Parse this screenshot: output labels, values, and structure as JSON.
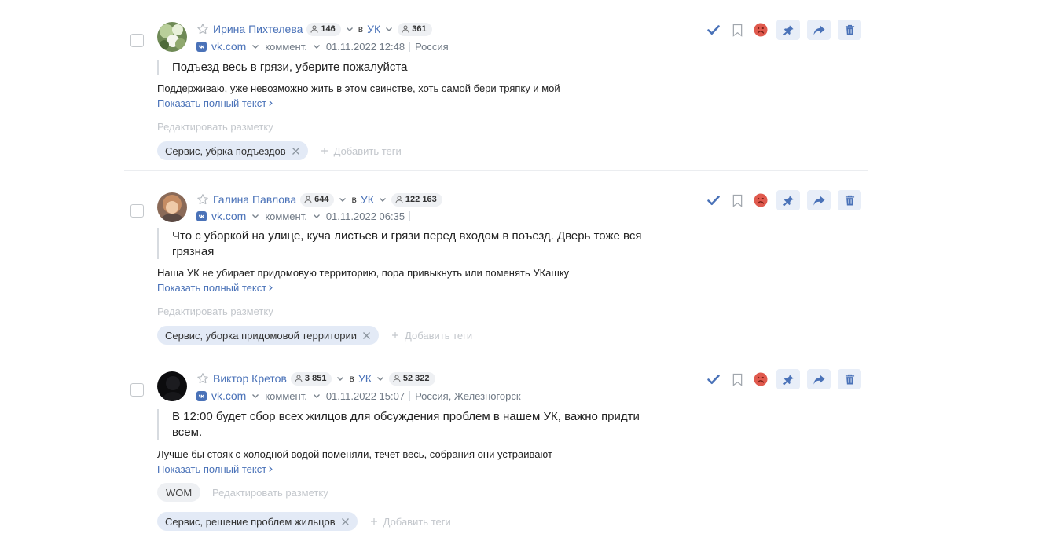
{
  "posts": [
    {
      "author": "Ирина Пихтелева",
      "followers": "146",
      "in_label": "в",
      "uk_label": "УК",
      "reach": "361",
      "source": "vk.com",
      "type": "коммент.",
      "datetime": "01.11.2022 12:48",
      "location": "Россия",
      "quote_lines": [
        "Подъезд весь в грязи, уберите пожалуйста"
      ],
      "comment": "Поддерживаю, уже невозможно жить в этом свинстве, хоть самой бери тряпку и мой",
      "show_full": "Показать полный текст",
      "edit_markup": "Редактировать разметку",
      "tag": "Сервис, убрка подъездов",
      "add_tags": "Добавить теги"
    },
    {
      "author": "Галина Павлова",
      "followers": "644",
      "in_label": "в",
      "uk_label": "УК",
      "reach": "122 163",
      "source": "vk.com",
      "type": "коммент.",
      "datetime": "01.11.2022 06:35",
      "location": "",
      "quote_lines": [
        "Что с уборкой на улице, куча листьев и грязи перед входом в поъезд. Дверь тоже вся",
        "грязная"
      ],
      "comment": "Наша УК не убирает придомовую территорию, пора привыкнуть или поменять УКашку",
      "show_full": "Показать полный текст",
      "edit_markup": "Редактировать разметку",
      "tag": "Сервис, уборка придомовой территории",
      "add_tags": "Добавить теги"
    },
    {
      "author": "Виктор Кретов",
      "followers": "3 851",
      "in_label": "в",
      "uk_label": "УК",
      "reach": "52 322",
      "source": "vk.com",
      "type": "коммент.",
      "datetime": "01.11.2022 15:07",
      "location": "Россия, Железногорск",
      "quote_lines": [
        "В 12:00 будет сбор всех жилцов для обсуждения проблем в нашем УК, важно придти",
        "всем."
      ],
      "comment": "Лучше бы стояк с холодной водой поменяли, течет весь, собрания они устраивают",
      "show_full": "Показать полный текст",
      "wom": "WOM",
      "edit_markup": "Редактировать разметку",
      "tag": "Сервис, решение проблем жильцов",
      "add_tags": "Добавить теги"
    }
  ],
  "colors": {
    "accent": "#4a72b8",
    "tag_bg": "#e3eaf6",
    "pill_bg": "#eef0f3",
    "negative": "#e05a4e",
    "muted": "#c3c7cc"
  },
  "icons": [
    "checkbox",
    "avatar",
    "star-icon",
    "audience-icon",
    "chevron-down-icon",
    "vk-icon",
    "check-icon",
    "bookmark-icon",
    "negative-sentiment-icon",
    "pin-icon",
    "share-icon",
    "trash-icon",
    "close-icon",
    "plus-icon",
    "chevron-right-icon"
  ]
}
